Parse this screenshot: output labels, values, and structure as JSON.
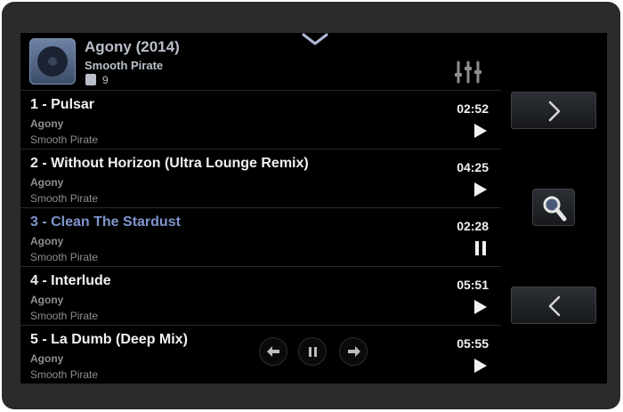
{
  "album": {
    "title": "Agony (2014)",
    "artist": "Smooth Pirate",
    "track_count": "9"
  },
  "tracks": [
    {
      "title": "1 - Pulsar",
      "album": "Agony",
      "artist": "Smooth Pirate",
      "duration": "02:52",
      "state": "play"
    },
    {
      "title": "2 - Without Horizon (Ultra Lounge Remix)",
      "album": "Agony",
      "artist": "Smooth Pirate",
      "duration": "04:25",
      "state": "play"
    },
    {
      "title": "3 - Clean The Stardust",
      "album": "Agony",
      "artist": "Smooth Pirate",
      "duration": "02:28",
      "state": "pause"
    },
    {
      "title": "4 - Interlude",
      "album": "Agony",
      "artist": "Smooth Pirate",
      "duration": "05:51",
      "state": "play"
    },
    {
      "title": "5 - La Dumb (Deep Mix)",
      "album": "Agony",
      "artist": "Smooth Pirate",
      "duration": "05:55",
      "state": "play"
    }
  ],
  "icons": {
    "collapse": "chevron-down-icon",
    "equalizer": "equalizer-icon",
    "next_page": "chevron-right-icon",
    "search": "search-icon",
    "prev_page": "chevron-left-icon",
    "mini_prev": "arrow-left-icon",
    "mini_pause": "pause-icon",
    "mini_next": "arrow-right-icon"
  },
  "colors": {
    "active_track": "#7f95cd",
    "background": "#000000",
    "frame": "#2b2b2b"
  }
}
